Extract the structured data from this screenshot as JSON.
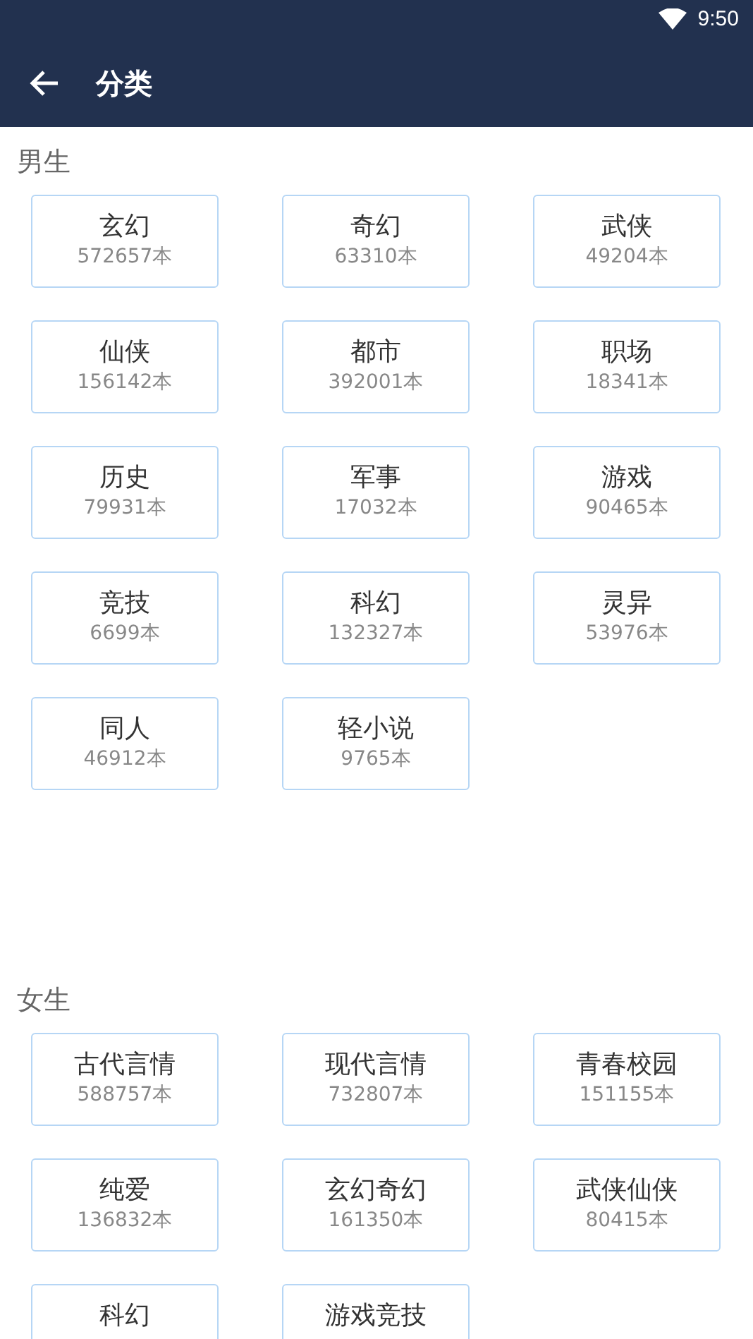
{
  "status_bar": {
    "time": "9:50"
  },
  "toolbar": {
    "title": "分类"
  },
  "sections": [
    {
      "title": "男生",
      "categories": [
        {
          "name": "玄幻",
          "count": "572657本"
        },
        {
          "name": "奇幻",
          "count": "63310本"
        },
        {
          "name": "武侠",
          "count": "49204本"
        },
        {
          "name": "仙侠",
          "count": "156142本"
        },
        {
          "name": "都市",
          "count": "392001本"
        },
        {
          "name": "职场",
          "count": "18341本"
        },
        {
          "name": "历史",
          "count": "79931本"
        },
        {
          "name": "军事",
          "count": "17032本"
        },
        {
          "name": "游戏",
          "count": "90465本"
        },
        {
          "name": "竞技",
          "count": "6699本"
        },
        {
          "name": "科幻",
          "count": "132327本"
        },
        {
          "name": "灵异",
          "count": "53976本"
        },
        {
          "name": "同人",
          "count": "46912本"
        },
        {
          "name": "轻小说",
          "count": "9765本"
        }
      ]
    },
    {
      "title": "女生",
      "categories": [
        {
          "name": "古代言情",
          "count": "588757本"
        },
        {
          "name": "现代言情",
          "count": "732807本"
        },
        {
          "name": "青春校园",
          "count": "151155本"
        },
        {
          "name": "纯爱",
          "count": "136832本"
        },
        {
          "name": "玄幻奇幻",
          "count": "161350本"
        },
        {
          "name": "武侠仙侠",
          "count": "80415本"
        },
        {
          "name": "科幻"
        },
        {
          "name": "游戏竞技"
        }
      ]
    }
  ]
}
